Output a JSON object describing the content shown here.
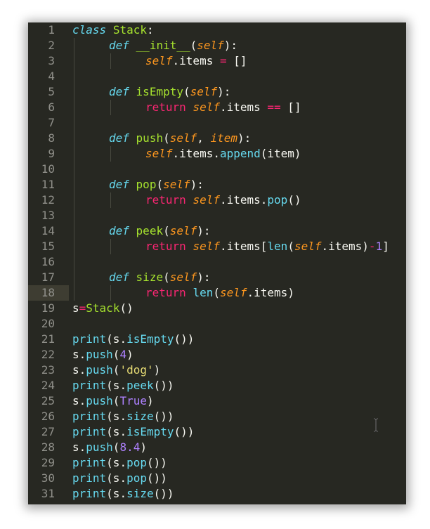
{
  "editor": {
    "current_line": 18,
    "colors": {
      "background": "#272822",
      "gutter_text": "#90908a",
      "current_line": "#3e3d32",
      "keyword": "#66d9ef",
      "class_name": "#a6e22e",
      "self": "#fd971f",
      "return": "#f92672",
      "number": "#ae81ff",
      "string": "#e6db74"
    },
    "lines": [
      {
        "n": "1",
        "indent": 0,
        "tokens": [
          [
            "kw",
            "class"
          ],
          [
            "pun",
            " "
          ],
          [
            "cls",
            "Stack"
          ],
          [
            "pun",
            ":"
          ]
        ]
      },
      {
        "n": "2",
        "indent": 1,
        "tokens": [
          [
            "kw",
            "def"
          ],
          [
            "pun",
            " "
          ],
          [
            "fn",
            "__init__"
          ],
          [
            "pun",
            "("
          ],
          [
            "self",
            "self"
          ],
          [
            "pun",
            "):"
          ]
        ]
      },
      {
        "n": "3",
        "indent": 2,
        "tokens": [
          [
            "self",
            "self"
          ],
          [
            "pun",
            ".items "
          ],
          [
            "op",
            "="
          ],
          [
            "pun",
            " []"
          ]
        ]
      },
      {
        "n": "4",
        "indent": 0,
        "tokens": []
      },
      {
        "n": "5",
        "indent": 1,
        "tokens": [
          [
            "kw",
            "def"
          ],
          [
            "pun",
            " "
          ],
          [
            "fn",
            "isEmpty"
          ],
          [
            "pun",
            "("
          ],
          [
            "self",
            "self"
          ],
          [
            "pun",
            "):"
          ]
        ]
      },
      {
        "n": "6",
        "indent": 2,
        "tokens": [
          [
            "ret",
            "return"
          ],
          [
            "pun",
            " "
          ],
          [
            "self",
            "self"
          ],
          [
            "pun",
            ".items "
          ],
          [
            "op",
            "=="
          ],
          [
            "pun",
            " []"
          ]
        ]
      },
      {
        "n": "7",
        "indent": 0,
        "tokens": []
      },
      {
        "n": "8",
        "indent": 1,
        "tokens": [
          [
            "kw",
            "def"
          ],
          [
            "pun",
            " "
          ],
          [
            "fn",
            "push"
          ],
          [
            "pun",
            "("
          ],
          [
            "self",
            "self"
          ],
          [
            "pun",
            ", "
          ],
          [
            "param",
            "item"
          ],
          [
            "pun",
            "):"
          ]
        ]
      },
      {
        "n": "9",
        "indent": 2,
        "tokens": [
          [
            "self",
            "self"
          ],
          [
            "pun",
            ".items."
          ],
          [
            "bi",
            "append"
          ],
          [
            "pun",
            "(item)"
          ]
        ]
      },
      {
        "n": "10",
        "indent": 0,
        "tokens": []
      },
      {
        "n": "11",
        "indent": 1,
        "tokens": [
          [
            "kw",
            "def"
          ],
          [
            "pun",
            " "
          ],
          [
            "fn",
            "pop"
          ],
          [
            "pun",
            "("
          ],
          [
            "self",
            "self"
          ],
          [
            "pun",
            "):"
          ]
        ]
      },
      {
        "n": "12",
        "indent": 2,
        "tokens": [
          [
            "ret",
            "return"
          ],
          [
            "pun",
            " "
          ],
          [
            "self",
            "self"
          ],
          [
            "pun",
            ".items."
          ],
          [
            "bi",
            "pop"
          ],
          [
            "pun",
            "()"
          ]
        ]
      },
      {
        "n": "13",
        "indent": 0,
        "tokens": []
      },
      {
        "n": "14",
        "indent": 1,
        "tokens": [
          [
            "kw",
            "def"
          ],
          [
            "pun",
            " "
          ],
          [
            "fn",
            "peek"
          ],
          [
            "pun",
            "("
          ],
          [
            "self",
            "self"
          ],
          [
            "pun",
            "):"
          ]
        ]
      },
      {
        "n": "15",
        "indent": 2,
        "tokens": [
          [
            "ret",
            "return"
          ],
          [
            "pun",
            " "
          ],
          [
            "self",
            "self"
          ],
          [
            "pun",
            ".items["
          ],
          [
            "bi",
            "len"
          ],
          [
            "pun",
            "("
          ],
          [
            "self",
            "self"
          ],
          [
            "pun",
            ".items)"
          ],
          [
            "op",
            "-"
          ],
          [
            "num",
            "1"
          ],
          [
            "pun",
            "]"
          ]
        ]
      },
      {
        "n": "16",
        "indent": 0,
        "tokens": []
      },
      {
        "n": "17",
        "indent": 1,
        "tokens": [
          [
            "kw",
            "def"
          ],
          [
            "pun",
            " "
          ],
          [
            "fn",
            "size"
          ],
          [
            "pun",
            "("
          ],
          [
            "self",
            "self"
          ],
          [
            "pun",
            "):"
          ]
        ]
      },
      {
        "n": "18",
        "indent": 2,
        "tokens": [
          [
            "ret",
            "return"
          ],
          [
            "pun",
            " "
          ],
          [
            "bi",
            "len"
          ],
          [
            "pun",
            "("
          ],
          [
            "self",
            "self"
          ],
          [
            "pun",
            ".items)"
          ]
        ]
      },
      {
        "n": "19",
        "indent": 0,
        "tokens": [
          [
            "pun",
            "s"
          ],
          [
            "op",
            "="
          ],
          [
            "cls",
            "Stack"
          ],
          [
            "pun",
            "()"
          ]
        ]
      },
      {
        "n": "20",
        "indent": 0,
        "tokens": []
      },
      {
        "n": "21",
        "indent": 0,
        "tokens": [
          [
            "bi",
            "print"
          ],
          [
            "pun",
            "(s."
          ],
          [
            "bi",
            "isEmpty"
          ],
          [
            "pun",
            "())"
          ]
        ]
      },
      {
        "n": "22",
        "indent": 0,
        "tokens": [
          [
            "pun",
            "s."
          ],
          [
            "bi",
            "push"
          ],
          [
            "pun",
            "("
          ],
          [
            "num",
            "4"
          ],
          [
            "pun",
            ")"
          ]
        ]
      },
      {
        "n": "23",
        "indent": 0,
        "tokens": [
          [
            "pun",
            "s."
          ],
          [
            "bi",
            "push"
          ],
          [
            "pun",
            "("
          ],
          [
            "str",
            "'dog'"
          ],
          [
            "pun",
            ")"
          ]
        ]
      },
      {
        "n": "24",
        "indent": 0,
        "tokens": [
          [
            "bi",
            "print"
          ],
          [
            "pun",
            "(s."
          ],
          [
            "bi",
            "peek"
          ],
          [
            "pun",
            "())"
          ]
        ]
      },
      {
        "n": "25",
        "indent": 0,
        "tokens": [
          [
            "pun",
            "s."
          ],
          [
            "bi",
            "push"
          ],
          [
            "pun",
            "("
          ],
          [
            "const",
            "True"
          ],
          [
            "pun",
            ")"
          ]
        ]
      },
      {
        "n": "26",
        "indent": 0,
        "tokens": [
          [
            "bi",
            "print"
          ],
          [
            "pun",
            "(s."
          ],
          [
            "bi",
            "size"
          ],
          [
            "pun",
            "())"
          ]
        ]
      },
      {
        "n": "27",
        "indent": 0,
        "tokens": [
          [
            "bi",
            "print"
          ],
          [
            "pun",
            "(s."
          ],
          [
            "bi",
            "isEmpty"
          ],
          [
            "pun",
            "())"
          ]
        ]
      },
      {
        "n": "28",
        "indent": 0,
        "tokens": [
          [
            "pun",
            "s."
          ],
          [
            "bi",
            "push"
          ],
          [
            "pun",
            "("
          ],
          [
            "num",
            "8.4"
          ],
          [
            "pun",
            ")"
          ]
        ]
      },
      {
        "n": "29",
        "indent": 0,
        "tokens": [
          [
            "bi",
            "print"
          ],
          [
            "pun",
            "(s."
          ],
          [
            "bi",
            "pop"
          ],
          [
            "pun",
            "())"
          ]
        ]
      },
      {
        "n": "30",
        "indent": 0,
        "tokens": [
          [
            "bi",
            "print"
          ],
          [
            "pun",
            "(s."
          ],
          [
            "bi",
            "pop"
          ],
          [
            "pun",
            "())"
          ]
        ]
      },
      {
        "n": "31",
        "indent": 0,
        "tokens": [
          [
            "bi",
            "print"
          ],
          [
            "pun",
            "(s."
          ],
          [
            "bi",
            "size"
          ],
          [
            "pun",
            "())"
          ]
        ]
      }
    ]
  },
  "mouse_cursor": {
    "icon": "text-cursor-icon"
  }
}
